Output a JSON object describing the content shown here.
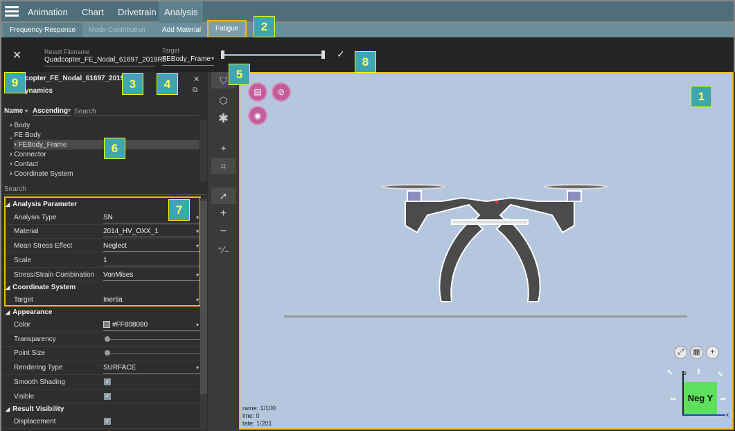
{
  "menubar": {
    "menu_icon": "hamburger-icon",
    "tabs": [
      "Animation",
      "Chart",
      "Drivetrain",
      "Analysis"
    ]
  },
  "subtabs": [
    "Frequency Response",
    "Mode Contribution",
    "Add Material",
    "Fatigue"
  ],
  "toolbar": {
    "close_icon": "close-icon",
    "result_filename_label": "Result Filename",
    "result_filename": "Quadcopter_FE_Nodal_61697_2019R3",
    "target_label": "Target",
    "target_value": "FEBody_Frame",
    "confirm_icon": "check-icon"
  },
  "badges": [
    "1",
    "2",
    "3",
    "4",
    "5",
    "6",
    "7",
    "8",
    "9"
  ],
  "left": {
    "title_line1": "copter_FE_Nodal_61697_2019R3",
    "title_line2": "ynamics",
    "sort_name": "Name",
    "sort_order": "Ascending",
    "search_placeholder": "Search",
    "tree": [
      "Body",
      "FE Body",
      "FEBody_Frame",
      "Connector",
      "Contact",
      "Coordinate System"
    ],
    "search2_placeholder": "Search",
    "sections": {
      "analysis_parameter": "Analysis Parameter",
      "coordinate_system": "Coordinate System",
      "appearance": "Appearance",
      "result_visibility": "Result Visibility"
    },
    "props": {
      "analysis_type": {
        "k": "Analysis Type",
        "v": "SN"
      },
      "material": {
        "k": "Material",
        "v": "2014_HV_OXX_1"
      },
      "mean_stress": {
        "k": "Mean Stress Effect",
        "v": "Neglect"
      },
      "scale": {
        "k": "Scale",
        "v": "1"
      },
      "combination": {
        "k": "Stress/Strain Combination",
        "v": "VonMises"
      },
      "target": {
        "k": "Target",
        "v": "Inertia"
      },
      "color": {
        "k": "Color",
        "v": "#FF808080"
      },
      "transparency": {
        "k": "Transparency"
      },
      "point_size": {
        "k": "Point Size"
      },
      "rendering": {
        "k": "Rendering Type",
        "v": "SURFACE"
      },
      "smooth": {
        "k": "Smooth Shading"
      },
      "visible": {
        "k": "Visible"
      },
      "displacement": {
        "k": "Displacement"
      }
    }
  },
  "viewport": {
    "frame": "rame: 1/100",
    "time": "ime: 0",
    "state": "tate: 1/201",
    "view_label": "Neg Y",
    "axis_z": "z",
    "axis_x": "x"
  }
}
